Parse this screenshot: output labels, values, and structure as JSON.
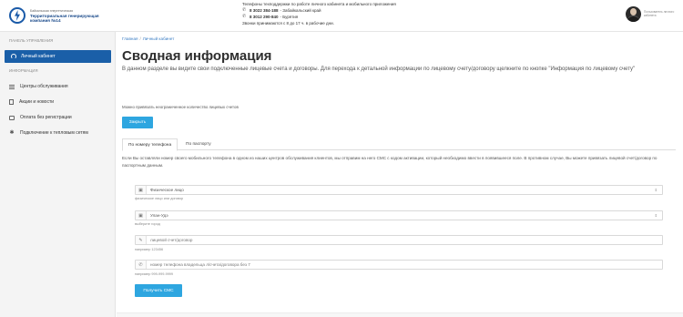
{
  "header": {
    "logo": {
      "line1": "Байкальская энергетическая",
      "line2": "Территориальная генерирующая",
      "line3": "компания №14"
    },
    "support_title": "Телефоны техподдержки по работе личного кабинета и мобильного приложения",
    "phones": [
      {
        "number": "8 3022 384-188",
        "region": "- Забайкальский край"
      },
      {
        "number": "8 3012 290-840",
        "region": "- Бурятия"
      }
    ],
    "hours": "Звонки принимаются с 8 до 17 ч. в рабочие дни.",
    "user_name": "Пользователь личного кабинета"
  },
  "sidebar": {
    "panel_heading": "ПАНЕЛЬ УПРАВЛЕНИЯ",
    "active_item": "Личный кабинет",
    "info_heading": "ИНФОРМАЦИЯ",
    "items": [
      {
        "label": "Центры обслуживания",
        "icon": "list-icon"
      },
      {
        "label": "Акции и новости",
        "icon": "news-icon"
      },
      {
        "label": "Оплата без регистрации",
        "icon": "card-icon"
      },
      {
        "label": "Подключение к тепловым сетям",
        "icon": "connect-icon"
      }
    ]
  },
  "content": {
    "breadcrumb": [
      "Главная",
      "Личный кабинет"
    ],
    "title": "Сводная информация",
    "intro": "В данном разделе вы видите свои подключенные лицевые счета и договоры. Для перехода к детальной информации по лицевому счету/договору щелкните по кнопке \"Информация по лицевому счету\"",
    "note": "Можно привязать неограниченное количество лицевых счетов",
    "close_button": "Закрыть",
    "tabs": [
      "По номеру телефона",
      "По паспорту"
    ],
    "tab_description": "Если Вы оставляли номер своего мобильного телефона в одном из наших центров обслуживания клиентов, мы отправим на него СМС с кодом активации, который необходимо ввести в появившееся поле. В противном случае, Вы можете привязать лицевой счет/договор по паспортным данным.",
    "form": {
      "client_type": {
        "value": "Физическое лицо",
        "hint": "физическое лицо или договор"
      },
      "city": {
        "value": "Улан-Удэ",
        "hint": "выберите город"
      },
      "account": {
        "placeholder": "лицевой счет/договор",
        "hint": "например 123456"
      },
      "phone": {
        "placeholder": "номер телефона владельца л/счета/договора без 7",
        "hint": "например 999-999-9999"
      },
      "submit": "Получить СМС"
    }
  }
}
